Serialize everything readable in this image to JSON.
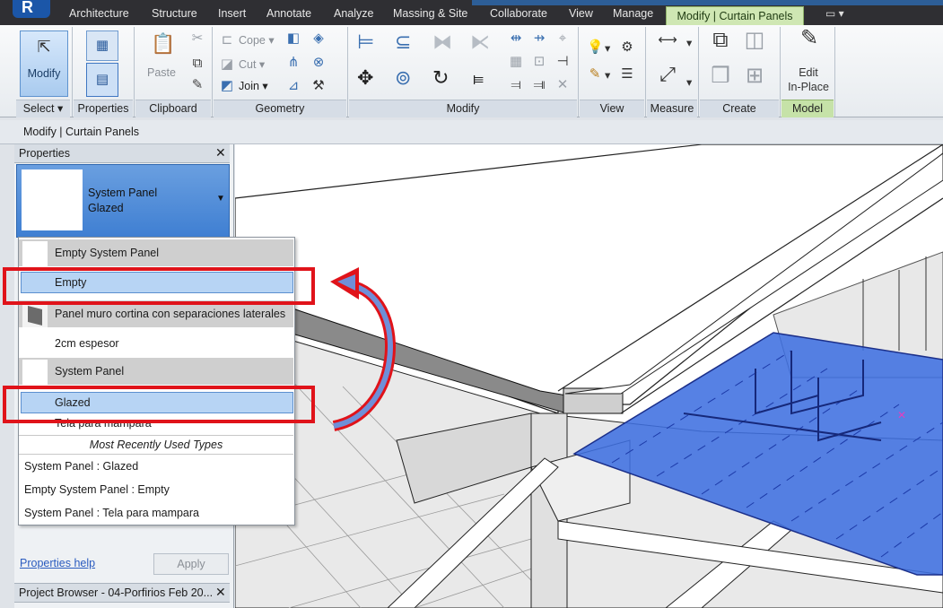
{
  "ribbon_tabs": [
    "Architecture",
    "Structure",
    "Insert",
    "Annotate",
    "Analyze",
    "Massing & Site",
    "Collaborate",
    "View",
    "Manage"
  ],
  "active_tab": "Modify | Curtain Panels",
  "ribbon": {
    "select": {
      "button": "Modify",
      "panel": "Select"
    },
    "properties": {
      "panel": "Properties"
    },
    "clipboard": {
      "paste": "Paste",
      "panel": "Clipboard"
    },
    "geometry": {
      "cope": "Cope",
      "cut": "Cut",
      "join": "Join",
      "panel": "Geometry"
    },
    "modify": {
      "panel": "Modify"
    },
    "view": {
      "panel": "View"
    },
    "measure": {
      "panel": "Measure"
    },
    "create": {
      "panel": "Create"
    },
    "model": {
      "button_line1": "Edit",
      "button_line2": "In-Place",
      "panel": "Model"
    }
  },
  "context_bar": "Modify | Curtain Panels",
  "properties_palette": {
    "title": "Properties",
    "close": "✕",
    "type_family": "System Panel",
    "type_name": "Glazed",
    "dropdown": [
      {
        "label": "Empty System Panel",
        "state": "header"
      },
      {
        "label": "Empty",
        "state": "selected"
      },
      {
        "label": "Panel muro cortina con separaciones laterales",
        "state": "header"
      },
      {
        "label": "2cm espesor",
        "state": "normal"
      },
      {
        "label": "System Panel",
        "state": "header"
      },
      {
        "label": "Glazed",
        "state": "selected"
      },
      {
        "label": "Tela para mampara",
        "state": "normal"
      }
    ],
    "mru_header": "Most Recently Used Types",
    "mru": [
      "System Panel : Glazed",
      "Empty System Panel : Empty",
      "System Panel : Tela para mampara"
    ],
    "help_link": "Properties help",
    "apply": "Apply"
  },
  "project_browser": {
    "title": "Project Browser - 04-Porfirios Feb 20...",
    "close": "✕"
  },
  "colors": {
    "accent_tab": "#cfe7b3",
    "selection": "#b7d4f4",
    "highlight_red": "#e0131a",
    "panel_blue": "#3f6fe0"
  }
}
